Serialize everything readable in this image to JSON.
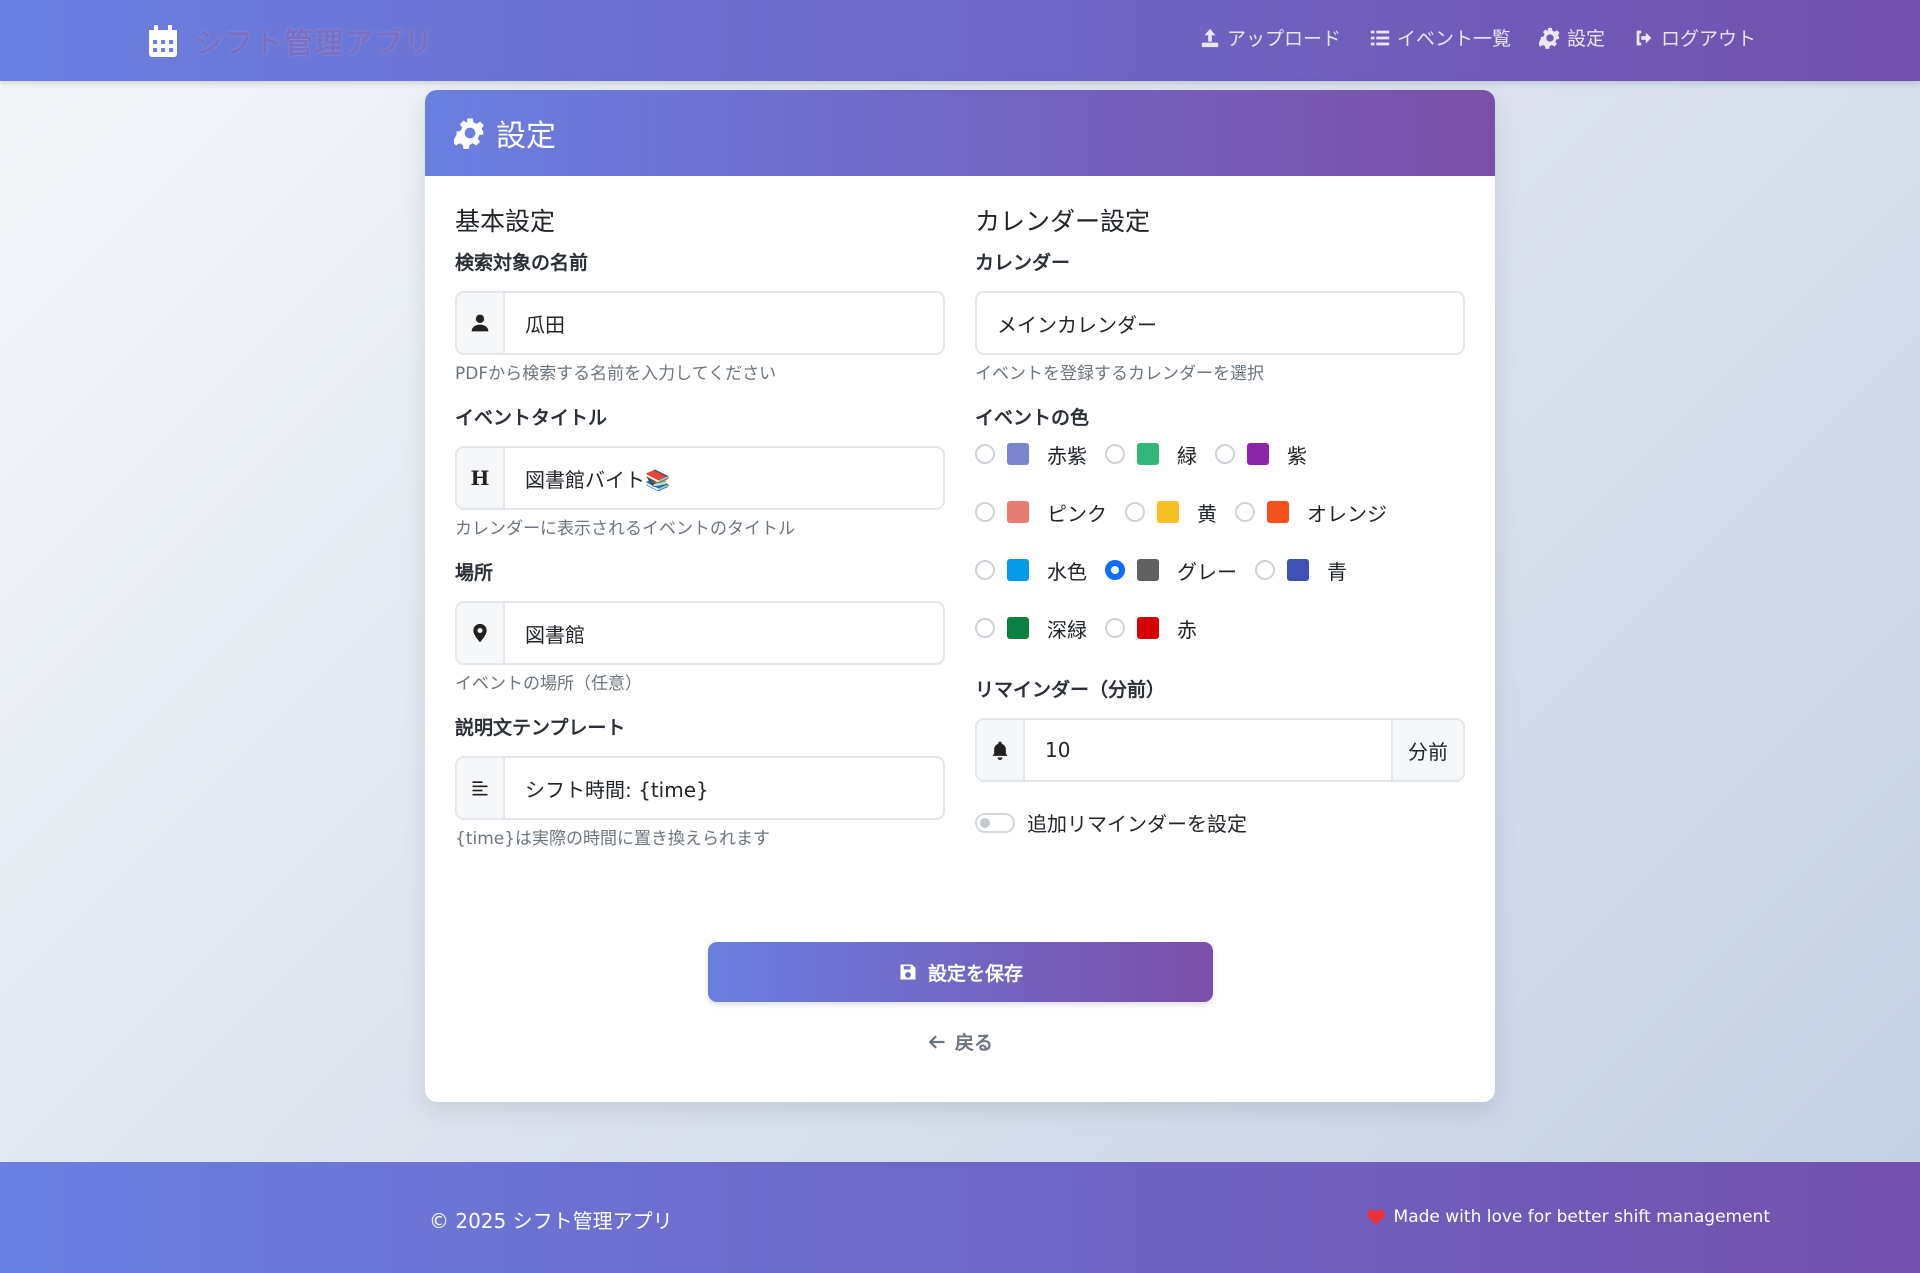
{
  "navbar": {
    "brand": "シフト管理アプリ",
    "links": [
      {
        "label": "アップロード",
        "icon": "upload-icon"
      },
      {
        "label": "イベント一覧",
        "icon": "list-icon"
      },
      {
        "label": "設定",
        "icon": "gear-icon"
      },
      {
        "label": "ログアウト",
        "icon": "logout-icon"
      }
    ]
  },
  "card": {
    "title": "設定",
    "basic": {
      "section_title": "基本設定",
      "name_label": "検索対象の名前",
      "name_value": "瓜田",
      "name_help": "PDFから検索する名前を入力してください",
      "event_title_label": "イベントタイトル",
      "event_title_icon": "H",
      "event_title_value": "図書館バイト📚",
      "event_title_help": "カレンダーに表示されるイベントのタイトル",
      "location_label": "場所",
      "location_value": "図書館",
      "location_help": "イベントの場所（任意）",
      "desc_label": "説明文テンプレート",
      "desc_value": "シフト時間: {time}",
      "desc_help": "{time}は実際の時間に置き換えられます"
    },
    "calendar": {
      "section_title": "カレンダー設定",
      "calendar_label": "カレンダー",
      "calendar_value": "メインカレンダー",
      "calendar_help": "イベントを登録するカレンダーを選択",
      "color_label": "イベントの色",
      "colors": [
        {
          "name": "赤紫",
          "hex": "#7986cb",
          "selected": false
        },
        {
          "name": "緑",
          "hex": "#33b679",
          "selected": false
        },
        {
          "name": "紫",
          "hex": "#8e24aa",
          "selected": false
        },
        {
          "name": "ピンク",
          "hex": "#e67c73",
          "selected": false
        },
        {
          "name": "黄",
          "hex": "#f6bf26",
          "selected": false
        },
        {
          "name": "オレンジ",
          "hex": "#f4511e",
          "selected": false
        },
        {
          "name": "水色",
          "hex": "#039be5",
          "selected": false
        },
        {
          "name": "グレー",
          "hex": "#616161",
          "selected": true
        },
        {
          "name": "青",
          "hex": "#3f51b5",
          "selected": false
        },
        {
          "name": "深緑",
          "hex": "#0b8043",
          "selected": false
        },
        {
          "name": "赤",
          "hex": "#d50000",
          "selected": false
        }
      ],
      "reminder_label": "リマインダー（分前）",
      "reminder_value": "10",
      "reminder_suffix": "分前",
      "extra_reminder_label": "追加リマインダーを設定",
      "extra_reminder_on": false
    },
    "save_label": "設定を保存",
    "back_label": "戻る"
  },
  "footer": {
    "copyright": "© 2025 シフト管理アプリ",
    "tagline": "Made with love for better shift management"
  },
  "theme": {
    "gradient_start": "#6a7fe0",
    "gradient_end": "#7a4fa8",
    "radio_accent": "#0d6efd",
    "heart": "#e8333f"
  }
}
